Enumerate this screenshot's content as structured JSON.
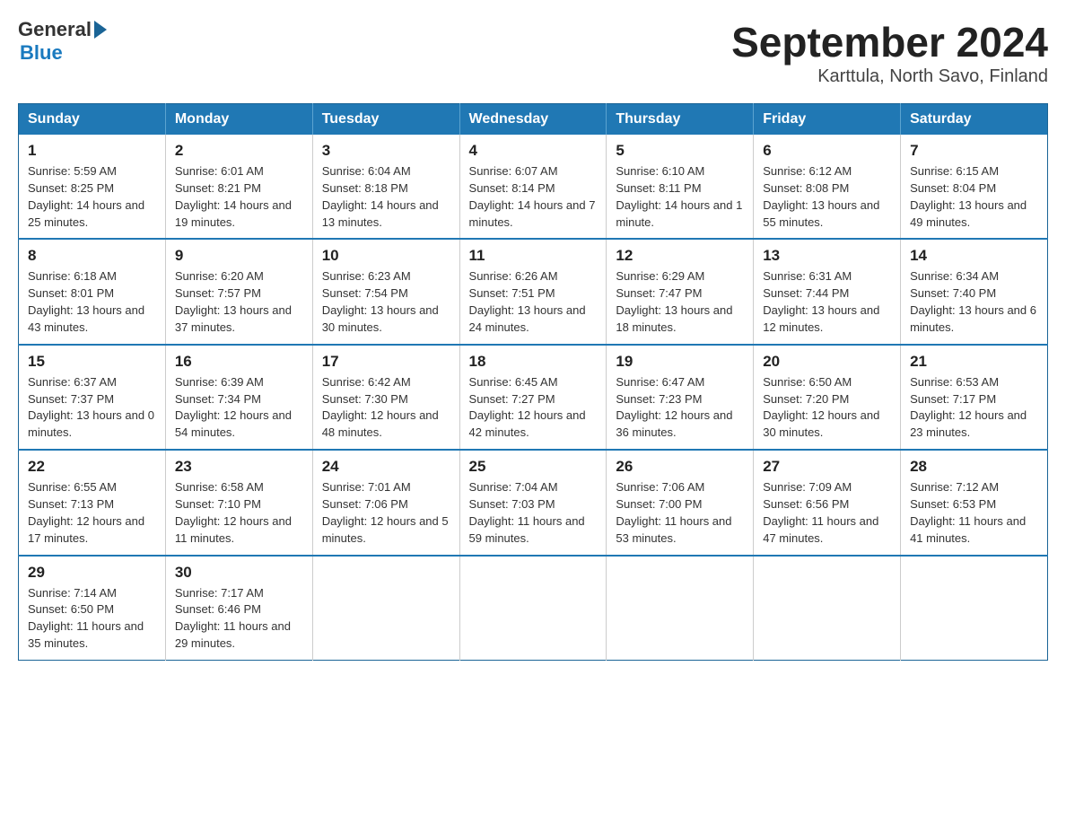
{
  "header": {
    "logo_general": "General",
    "logo_blue": "Blue",
    "title": "September 2024",
    "subtitle": "Karttula, North Savo, Finland"
  },
  "days_of_week": [
    "Sunday",
    "Monday",
    "Tuesday",
    "Wednesday",
    "Thursday",
    "Friday",
    "Saturday"
  ],
  "weeks": [
    [
      {
        "day": "1",
        "sunrise": "5:59 AM",
        "sunset": "8:25 PM",
        "daylight": "14 hours and 25 minutes."
      },
      {
        "day": "2",
        "sunrise": "6:01 AM",
        "sunset": "8:21 PM",
        "daylight": "14 hours and 19 minutes."
      },
      {
        "day": "3",
        "sunrise": "6:04 AM",
        "sunset": "8:18 PM",
        "daylight": "14 hours and 13 minutes."
      },
      {
        "day": "4",
        "sunrise": "6:07 AM",
        "sunset": "8:14 PM",
        "daylight": "14 hours and 7 minutes."
      },
      {
        "day": "5",
        "sunrise": "6:10 AM",
        "sunset": "8:11 PM",
        "daylight": "14 hours and 1 minute."
      },
      {
        "day": "6",
        "sunrise": "6:12 AM",
        "sunset": "8:08 PM",
        "daylight": "13 hours and 55 minutes."
      },
      {
        "day": "7",
        "sunrise": "6:15 AM",
        "sunset": "8:04 PM",
        "daylight": "13 hours and 49 minutes."
      }
    ],
    [
      {
        "day": "8",
        "sunrise": "6:18 AM",
        "sunset": "8:01 PM",
        "daylight": "13 hours and 43 minutes."
      },
      {
        "day": "9",
        "sunrise": "6:20 AM",
        "sunset": "7:57 PM",
        "daylight": "13 hours and 37 minutes."
      },
      {
        "day": "10",
        "sunrise": "6:23 AM",
        "sunset": "7:54 PM",
        "daylight": "13 hours and 30 minutes."
      },
      {
        "day": "11",
        "sunrise": "6:26 AM",
        "sunset": "7:51 PM",
        "daylight": "13 hours and 24 minutes."
      },
      {
        "day": "12",
        "sunrise": "6:29 AM",
        "sunset": "7:47 PM",
        "daylight": "13 hours and 18 minutes."
      },
      {
        "day": "13",
        "sunrise": "6:31 AM",
        "sunset": "7:44 PM",
        "daylight": "13 hours and 12 minutes."
      },
      {
        "day": "14",
        "sunrise": "6:34 AM",
        "sunset": "7:40 PM",
        "daylight": "13 hours and 6 minutes."
      }
    ],
    [
      {
        "day": "15",
        "sunrise": "6:37 AM",
        "sunset": "7:37 PM",
        "daylight": "13 hours and 0 minutes."
      },
      {
        "day": "16",
        "sunrise": "6:39 AM",
        "sunset": "7:34 PM",
        "daylight": "12 hours and 54 minutes."
      },
      {
        "day": "17",
        "sunrise": "6:42 AM",
        "sunset": "7:30 PM",
        "daylight": "12 hours and 48 minutes."
      },
      {
        "day": "18",
        "sunrise": "6:45 AM",
        "sunset": "7:27 PM",
        "daylight": "12 hours and 42 minutes."
      },
      {
        "day": "19",
        "sunrise": "6:47 AM",
        "sunset": "7:23 PM",
        "daylight": "12 hours and 36 minutes."
      },
      {
        "day": "20",
        "sunrise": "6:50 AM",
        "sunset": "7:20 PM",
        "daylight": "12 hours and 30 minutes."
      },
      {
        "day": "21",
        "sunrise": "6:53 AM",
        "sunset": "7:17 PM",
        "daylight": "12 hours and 23 minutes."
      }
    ],
    [
      {
        "day": "22",
        "sunrise": "6:55 AM",
        "sunset": "7:13 PM",
        "daylight": "12 hours and 17 minutes."
      },
      {
        "day": "23",
        "sunrise": "6:58 AM",
        "sunset": "7:10 PM",
        "daylight": "12 hours and 11 minutes."
      },
      {
        "day": "24",
        "sunrise": "7:01 AM",
        "sunset": "7:06 PM",
        "daylight": "12 hours and 5 minutes."
      },
      {
        "day": "25",
        "sunrise": "7:04 AM",
        "sunset": "7:03 PM",
        "daylight": "11 hours and 59 minutes."
      },
      {
        "day": "26",
        "sunrise": "7:06 AM",
        "sunset": "7:00 PM",
        "daylight": "11 hours and 53 minutes."
      },
      {
        "day": "27",
        "sunrise": "7:09 AM",
        "sunset": "6:56 PM",
        "daylight": "11 hours and 47 minutes."
      },
      {
        "day": "28",
        "sunrise": "7:12 AM",
        "sunset": "6:53 PM",
        "daylight": "11 hours and 41 minutes."
      }
    ],
    [
      {
        "day": "29",
        "sunrise": "7:14 AM",
        "sunset": "6:50 PM",
        "daylight": "11 hours and 35 minutes."
      },
      {
        "day": "30",
        "sunrise": "7:17 AM",
        "sunset": "6:46 PM",
        "daylight": "11 hours and 29 minutes."
      },
      null,
      null,
      null,
      null,
      null
    ]
  ],
  "labels": {
    "sunrise": "Sunrise:",
    "sunset": "Sunset:",
    "daylight": "Daylight:"
  }
}
